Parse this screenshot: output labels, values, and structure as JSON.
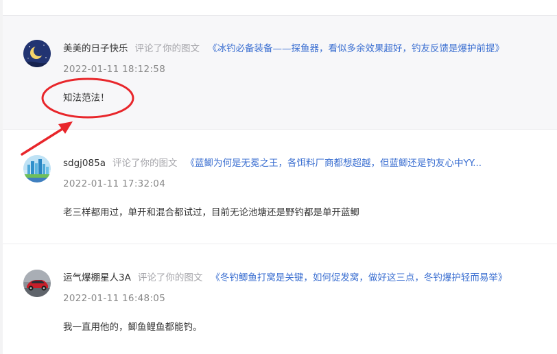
{
  "notifications": [
    {
      "username": "美美的日子快乐",
      "action": "评论了你的图文",
      "post_title": "《冰钓必备装备——探鱼器，看似多余效果超好，钓友反馈是爆护前提》",
      "timestamp": "2022-01-11 18:12:58",
      "comment": "知法范法！",
      "avatar": "moon-night-avatar"
    },
    {
      "username": "sdgj085a",
      "action": "评论了你的图文",
      "post_title": "《蓝鲫为何是无冕之王，各饵料厂商都想超越，但蓝鲫还是钓友心中YY...",
      "timestamp": "2022-01-11 17:32:04",
      "comment": "老三样都用过，单开和混合都试过，目前无论池塘还是野钓都是单开蓝鲫",
      "avatar": "city-skyline-avatar"
    },
    {
      "username": "运气爆棚星人3A",
      "action": "评论了你的图文",
      "post_title": "《冬钓鲫鱼打窝是关键，如何促发窝，做好这三点，冬钓爆护轻而易举》",
      "timestamp": "2022-01-11 16:48:05",
      "comment": "我一直用他的，鲫鱼鲤鱼都能钓。",
      "avatar": "red-car-avatar"
    }
  ],
  "colors": {
    "link": "#3b6fd1",
    "annotation": "#e8262b",
    "highlight_bg": "#f7f7f9"
  }
}
